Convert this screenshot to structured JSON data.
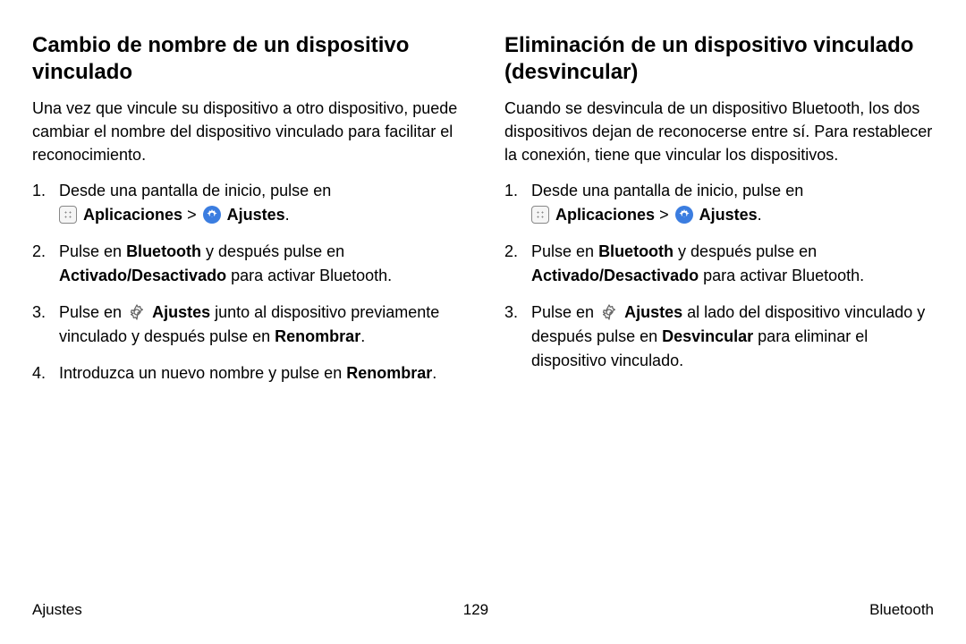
{
  "left": {
    "heading": "Cambio de nombre de un dispositivo vinculado",
    "intro": "Una vez que vincule su dispositivo a otro dispositivo, puede cambiar el nombre del dispositivo vinculado para facilitar el reconocimiento.",
    "step1_a": "Desde una pantalla de inicio, pulse en",
    "apps_label": "Aplicaciones",
    "angle": ">",
    "settings_label": "Ajustes",
    "step2_a": "Pulse en ",
    "step2_b": "Bluetooth",
    "step2_c": " y después pulse en ",
    "step2_d": "Activado/Desactivado",
    "step2_e": " para activar Bluetooth.",
    "step3_a": "Pulse en ",
    "step3_b": "Ajustes",
    "step3_c": " junto al dispositivo previamente vinculado y después pulse en ",
    "step3_d": "Renombrar",
    "step3_e": ".",
    "step4_a": "Introduzca un nuevo nombre y pulse en ",
    "step4_b": "Renombrar",
    "step4_c": "."
  },
  "right": {
    "heading": "Eliminación de un dispositivo vinculado (desvincular)",
    "intro": "Cuando se desvincula de un dispositivo Bluetooth, los dos dispositivos dejan de reconocerse entre sí. Para restablecer la conexión, tiene que vincular los dispositivos.",
    "step1_a": "Desde una pantalla de inicio, pulse en",
    "apps_label": "Aplicaciones",
    "angle": ">",
    "settings_label": "Ajustes",
    "step2_a": "Pulse en ",
    "step2_b": "Bluetooth",
    "step2_c": " y después pulse en ",
    "step2_d": "Activado/Desactivado",
    "step2_e": " para activar Bluetooth.",
    "step3_a": "Pulse en ",
    "step3_b": "Ajustes",
    "step3_c": " al lado del dispositivo vinculado y después pulse en ",
    "step3_d": "Desvincular",
    "step3_e": " para eliminar el dispositivo vinculado."
  },
  "footer": {
    "left": "Ajustes",
    "center": "129",
    "right": "Bluetooth"
  }
}
